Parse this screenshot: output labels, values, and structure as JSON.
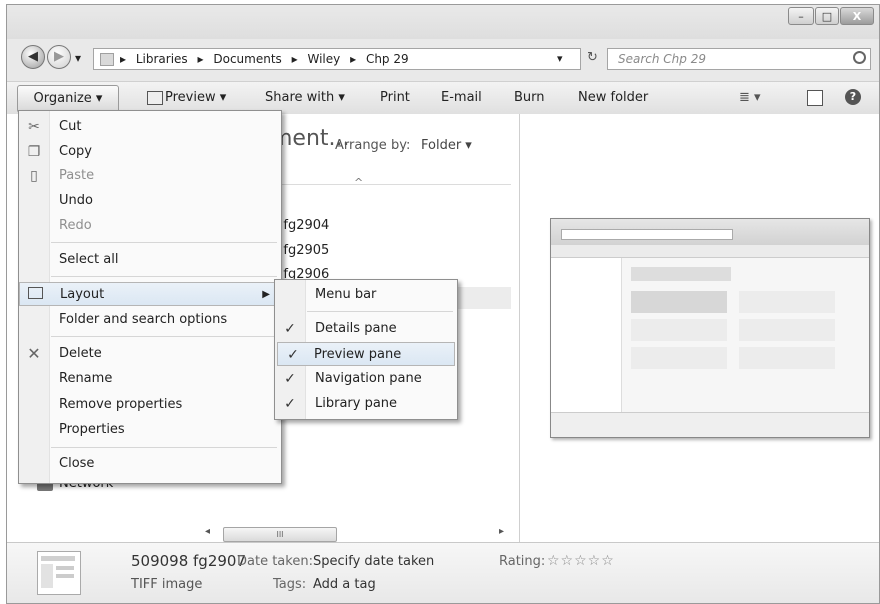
{
  "window": {
    "minimize_glyph": "–",
    "maximize_glyph": "□",
    "close_glyph": "X"
  },
  "address": {
    "segments": [
      "Libraries",
      "Documents",
      "Wiley",
      "Chp 29"
    ],
    "separator": "▸",
    "dropdown_glyph": "▾",
    "refresh_glyph": "↻"
  },
  "search": {
    "placeholder": "Search Chp 29"
  },
  "toolbar": {
    "organize": "Organize ▾",
    "preview": "Preview ▾",
    "share_with": "Share with ▾",
    "print": "Print",
    "email": "E-mail",
    "burn": "Burn",
    "new_folder": "New folder",
    "views_glyph": "≣ ▾",
    "help_glyph": "?"
  },
  "library": {
    "title_partial": "ment...",
    "arrange_by_label": "Arrange by:",
    "arrange_by_value": "Folder ▾",
    "sort_glyph": "^"
  },
  "files": [
    "3 fg2904",
    "3 fg2905",
    "3 fg2906"
  ],
  "nav_tree": {
    "network": "Network"
  },
  "organize_menu": {
    "cut": "Cut",
    "copy": "Copy",
    "paste": "Paste",
    "undo": "Undo",
    "redo": "Redo",
    "select_all": "Select all",
    "layout": "Layout",
    "folder_options": "Folder and search options",
    "delete": "Delete",
    "rename": "Rename",
    "remove_properties": "Remove properties",
    "properties": "Properties",
    "close": "Close"
  },
  "layout_submenu": [
    {
      "label": "Menu bar",
      "checked": false
    },
    {
      "label": "Details pane",
      "checked": true
    },
    {
      "label": "Preview pane",
      "checked": true
    },
    {
      "label": "Navigation pane",
      "checked": true
    },
    {
      "label": "Library pane",
      "checked": true
    }
  ],
  "check_glyph": "✓",
  "scrollbar": {
    "thumb_glyph": "III",
    "left_glyph": "◂",
    "right_glyph": "▸"
  },
  "details": {
    "filename": "509098 fg2907",
    "filetype": "TIFF image",
    "date_label": "Date taken:",
    "date_value": "Specify date taken",
    "tags_label": "Tags:",
    "tags_value": "Add a tag",
    "rating_label": "Rating:",
    "stars": "☆☆☆☆☆"
  }
}
